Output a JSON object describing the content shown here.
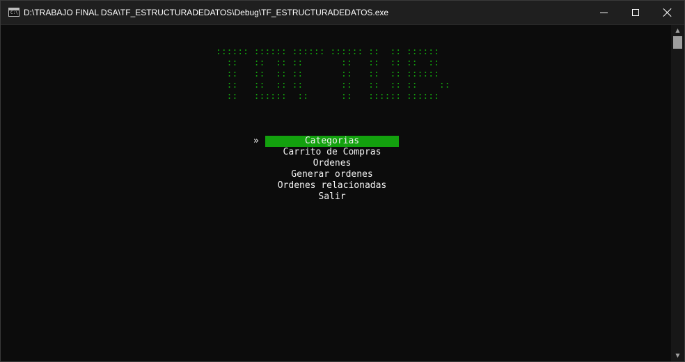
{
  "window": {
    "title": "D:\\TRABAJO FINAL DSA\\TF_ESTRUCTURADEDATOS\\Debug\\TF_ESTRUCTURADEDATOS.exe",
    "icon_text": "C:\\",
    "icon": "console-app-icon",
    "controls": {
      "minimize_icon": "minimize-icon",
      "maximize_icon": "maximize-icon",
      "close_icon": "close-icon"
    }
  },
  "console": {
    "banner_lines": [
      ":::::: :::::: :::::: :::::: ::  :: ::::::",
      "  ::   ::  :: ::       ::   ::  :: ::  ::",
      "  ::   ::  :: ::       ::   ::  :: ::::::",
      "  ::   ::  :: ::       ::   ::  :: ::    ::",
      "  ::   ::::::  ::      ::   :::::: ::::::"
    ],
    "banner_color": "#13a10e",
    "pointer": "»",
    "menu_items": [
      "Categorias",
      "Carrito de Compras",
      "Ordenes",
      "Generar ordenes",
      "Ordenes relacionadas",
      "Salir"
    ],
    "selected_index": 0,
    "highlight_color": "#13a10e",
    "text_color": "#f2f2f2",
    "background_color": "#0c0c0c"
  },
  "scrollbar": {
    "up_icon": "scroll-up-arrow-icon",
    "down_icon": "scroll-down-arrow-icon"
  }
}
